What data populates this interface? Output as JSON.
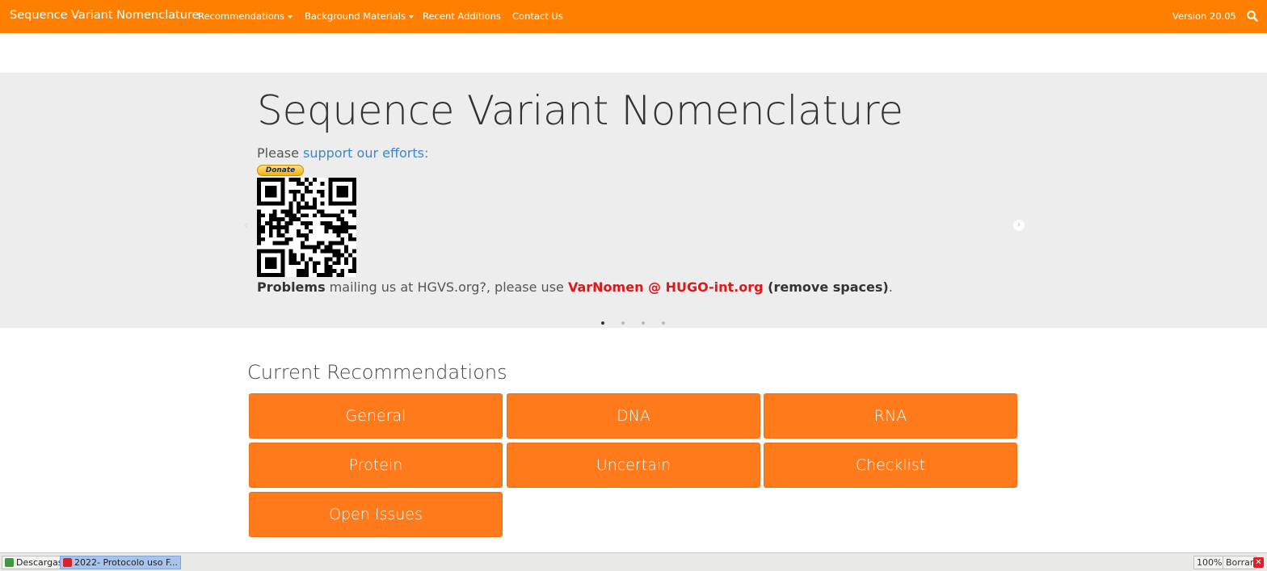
{
  "navbar": {
    "brand": "Sequence Variant Nomenclature",
    "items": [
      {
        "label": "Recommendations",
        "dropdown": true
      },
      {
        "label": "Background Materials",
        "dropdown": true
      },
      {
        "label": "Recent Additions",
        "dropdown": false
      },
      {
        "label": "Contact Us",
        "dropdown": false
      }
    ],
    "version": "Version 20.05",
    "search_icon": "search-icon",
    "color": "#ff8000"
  },
  "carousel": {
    "title": "Sequence Variant Nomenclature",
    "please_prefix": "Please ",
    "support_link": "support our efforts:",
    "donate_label": "Donate",
    "problems_bold": "Problems",
    "problems_text": " mailing us at HGVS.org?, please use ",
    "email": "VarNomen @ HUGO-int.org",
    "remove_spaces": " (remove spaces)",
    "end_punct": ".",
    "slides_total": 4,
    "active_slide": 1,
    "prev_icon": "chevron-left-icon",
    "next_icon": "chevron-right-icon"
  },
  "recommendations": {
    "title": "Current Recommendations",
    "buttons": [
      "General",
      "DNA",
      "RNA",
      "Protein",
      "Uncertain",
      "Checklist",
      "Open Issues"
    ],
    "button_color": "#ff7a1a"
  },
  "taskbar": {
    "downloads": "Descargas",
    "pdf_file": "2022- Protocolo uso F...",
    "zoom": "100%",
    "clear": "Borrar",
    "close_icon": "close-icon"
  }
}
